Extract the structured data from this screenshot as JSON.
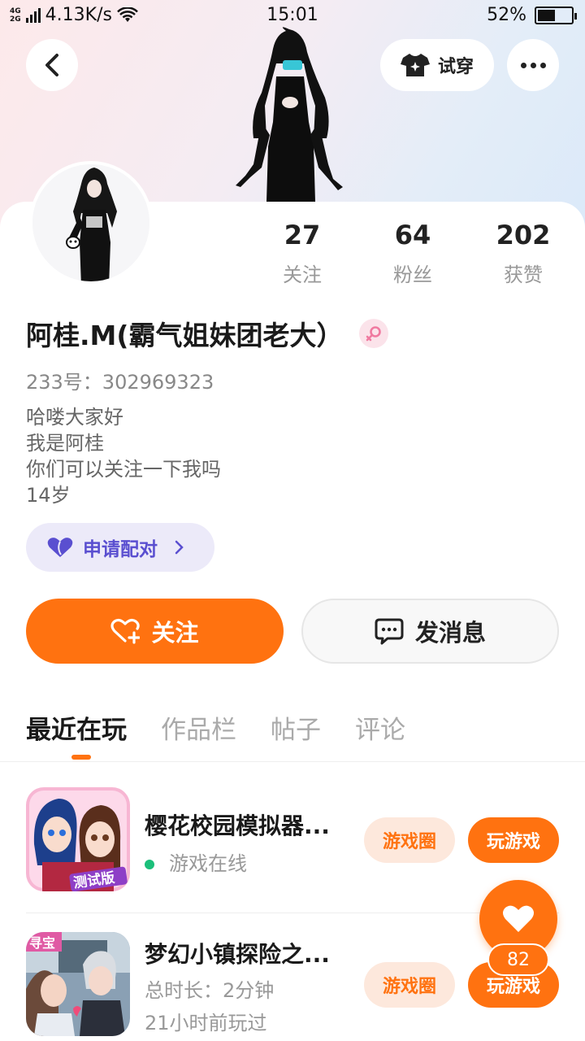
{
  "status_bar": {
    "network": "4G 2G",
    "speed": "4.13K/s",
    "time": "15:01",
    "battery": "52%",
    "battery_level": 0.52
  },
  "header": {
    "tryon_label": "试穿"
  },
  "stats": [
    {
      "value": "27",
      "label": "关注"
    },
    {
      "value": "64",
      "label": "粉丝"
    },
    {
      "value": "202",
      "label": "获赞"
    }
  ],
  "profile": {
    "name": "阿桂.M(霸气姐妹团老大）",
    "uid": "233号：302969323",
    "bio": [
      "哈喽大家好",
      "我是阿桂",
      "你们可以关注一下我吗",
      "14岁"
    ],
    "pair_label": "申请配对"
  },
  "actions": {
    "follow_label": "关注",
    "message_label": "发消息"
  },
  "tabs": [
    "最近在玩",
    "作品栏",
    "帖子",
    "评论"
  ],
  "games": [
    {
      "title": "樱花校园模拟器...",
      "status": "游戏在线",
      "circle_label": "游戏圈",
      "play_label": "玩游戏",
      "icon_badge": "测试版"
    },
    {
      "title": "梦幻小镇探险之...",
      "duration": "总时长：2分钟",
      "last_played": "21小时前玩过",
      "circle_label": "游戏圈",
      "play_label": "玩游戏",
      "icon_badge": "寻宝"
    }
  ],
  "fab": {
    "count": "82"
  },
  "colors": {
    "accent": "#ff7210",
    "online": "#1bbf7a",
    "pair": "#5a4fd0"
  }
}
